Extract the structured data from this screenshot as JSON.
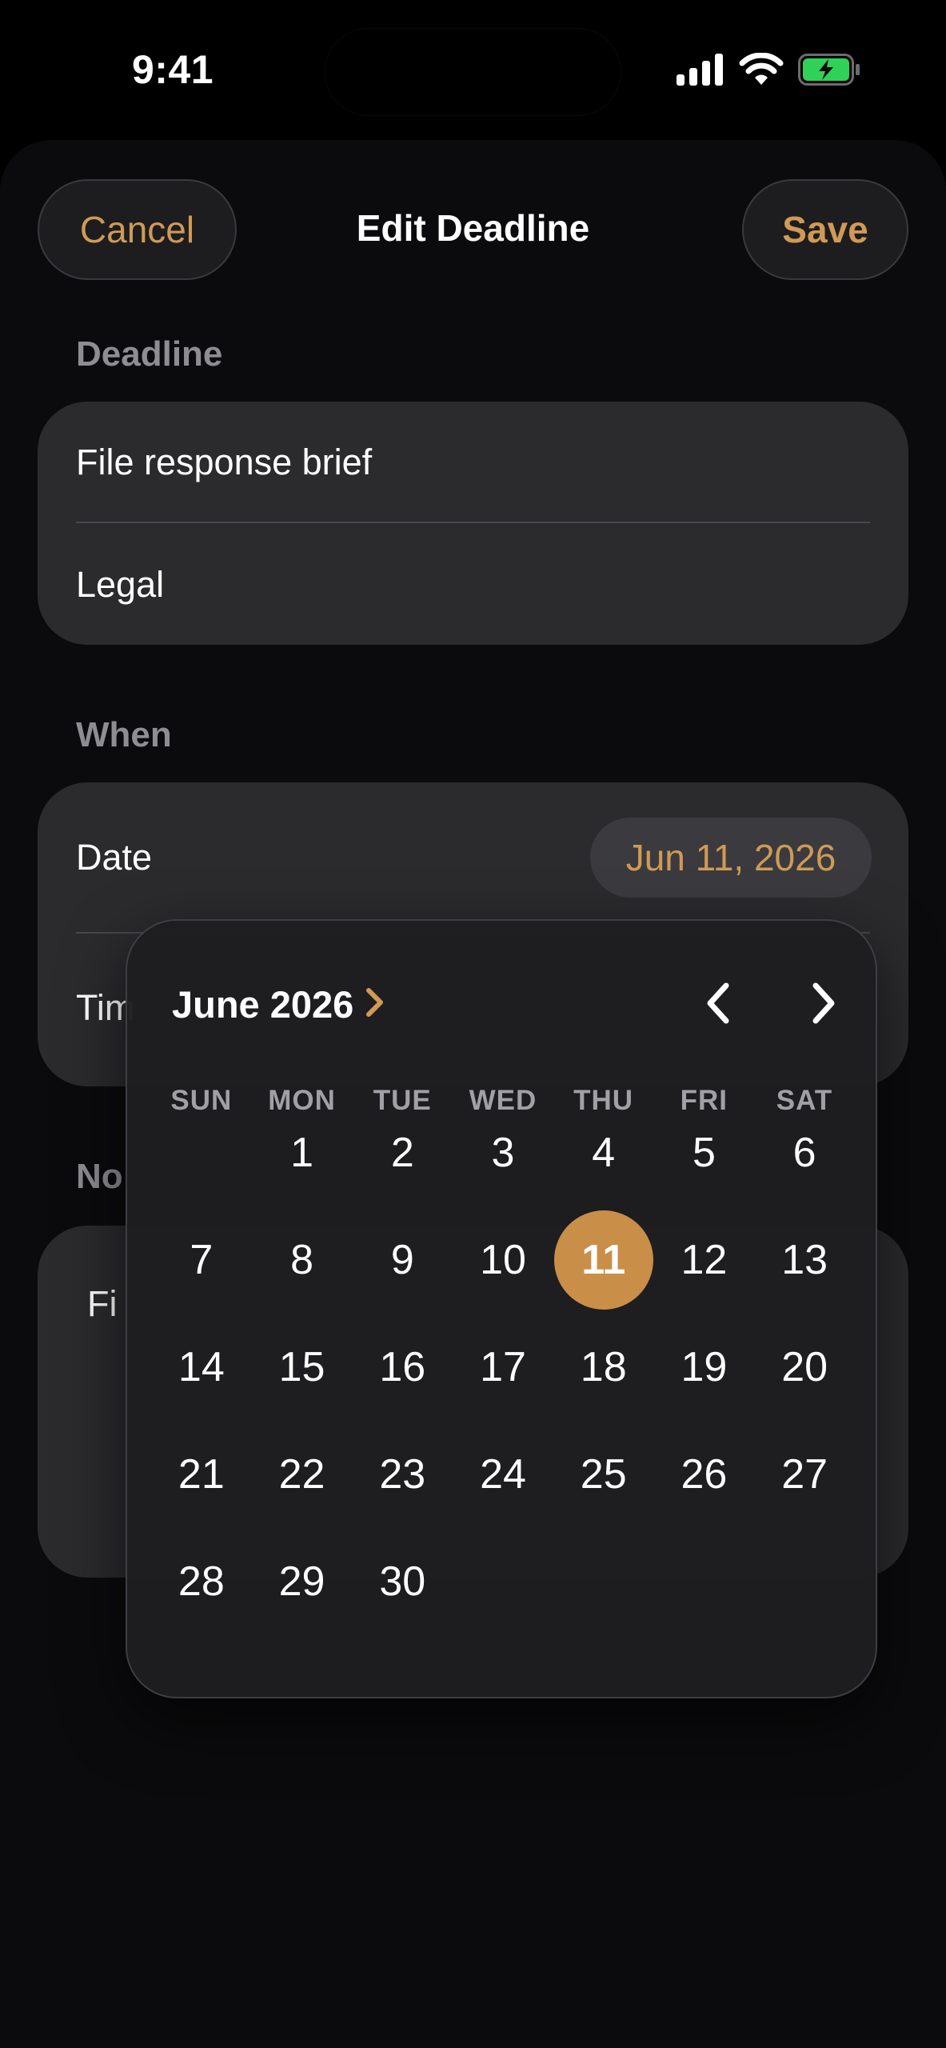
{
  "status_bar": {
    "time": "9:41",
    "icons": [
      "cellular-signal-icon",
      "wifi-icon",
      "battery-charging-icon"
    ]
  },
  "nav": {
    "cancel_label": "Cancel",
    "title": "Edit Deadline",
    "save_label": "Save"
  },
  "deadline_section": {
    "label": "Deadline",
    "title_value": "File response brief",
    "category_value": "Legal"
  },
  "when_section": {
    "label": "When",
    "date_label": "Date",
    "date_value": "Jun 11, 2026",
    "time_label_partial": "Tim"
  },
  "notes_section": {
    "label_partial": "No",
    "text_partial": "Fi"
  },
  "calendar": {
    "month_title": "June 2026",
    "weekdays": [
      "SUN",
      "MON",
      "TUE",
      "WED",
      "THU",
      "FRI",
      "SAT"
    ],
    "first_weekday_index": 1,
    "days_in_month": 30,
    "selected_day": 11
  },
  "colors": {
    "accent": "#d09a55",
    "selected_fill": "#c98f49",
    "card": "#2b2b2e",
    "sheet": "#0b0b0d",
    "battery_green": "#30d158"
  }
}
